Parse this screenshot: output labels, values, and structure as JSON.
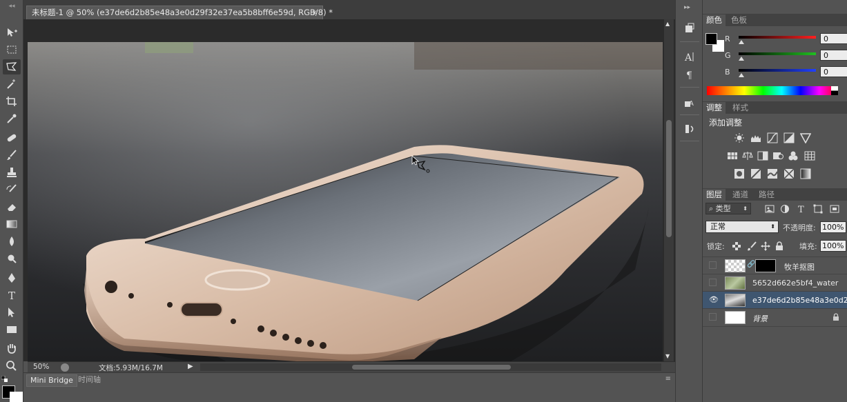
{
  "document": {
    "tab_title": "未标题-1 @ 50% (e37de6d2b85e48a3e0d29f32e37ea5b8bff6e59d, RGB/8) *",
    "close_glyph": "×",
    "zoom": "50%",
    "doc_info": "文档:5.93M/16.7M"
  },
  "bottom_tabs": {
    "mini_bridge": "Mini Bridge",
    "timeline": "时间轴"
  },
  "color_panel": {
    "tabs": [
      "颜色",
      "色板"
    ],
    "channels": [
      {
        "label": "R",
        "value": "0",
        "color": "#ff2020"
      },
      {
        "label": "G",
        "value": "0",
        "color": "#20c020"
      },
      {
        "label": "B",
        "value": "0",
        "color": "#2040ff"
      }
    ],
    "foreground": "#000000",
    "background": "#ffffff"
  },
  "adjust_panel": {
    "tabs": [
      "调整",
      "样式"
    ],
    "heading": "添加调整"
  },
  "layers_panel": {
    "tabs": [
      "图层",
      "通道",
      "路径"
    ],
    "filter_kind": "类型",
    "blend_mode": "正常",
    "opacity_label": "不透明度:",
    "opacity_value": "100%",
    "lock_label": "锁定:",
    "fill_label": "填充:",
    "fill_value": "100%",
    "layers": [
      {
        "name": "牧羊抠图",
        "visible": false
      },
      {
        "name": "5652d662e5bf4_water",
        "visible": false
      },
      {
        "name": "e37de6d2b85e48a3e0d2...",
        "visible": true,
        "selected": true
      },
      {
        "name": "背景",
        "visible": false,
        "locked": true
      }
    ]
  }
}
